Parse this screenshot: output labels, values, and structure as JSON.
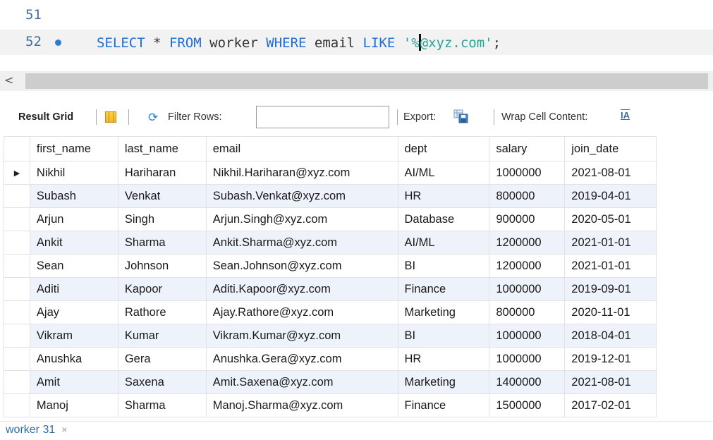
{
  "editor": {
    "lines": [
      {
        "number": "51"
      },
      {
        "number": "52"
      }
    ],
    "query": {
      "kw_select": "SELECT",
      "star": " * ",
      "kw_from": "FROM",
      "table": " worker ",
      "kw_where": "WHERE",
      "column": " email ",
      "kw_like": "LIKE",
      "space": " ",
      "str_open": "'%",
      "str_rest": "@xyz.com'",
      "semicolon": ";"
    }
  },
  "scrollbar": {
    "left_arrow": "<"
  },
  "toolbar": {
    "result_grid_label": "Result Grid",
    "filter_label": "Filter Rows:",
    "filter_value": "",
    "export_label": "Export:",
    "wrap_label": "Wrap Cell Content:",
    "wrap_icon_glyph": "IA"
  },
  "table": {
    "columns": [
      "first_name",
      "last_name",
      "email",
      "dept",
      "salary",
      "join_date"
    ],
    "rows": [
      [
        "Nikhil",
        "Hariharan",
        "Nikhil.Hariharan@xyz.com",
        "AI/ML",
        "1000000",
        "2021-08-01"
      ],
      [
        "Subash",
        "Venkat",
        "Subash.Venkat@xyz.com",
        "HR",
        "800000",
        "2019-04-01"
      ],
      [
        "Arjun",
        "Singh",
        "Arjun.Singh@xyz.com",
        "Database",
        "900000",
        "2020-05-01"
      ],
      [
        "Ankit",
        "Sharma",
        "Ankit.Sharma@xyz.com",
        "AI/ML",
        "1200000",
        "2021-01-01"
      ],
      [
        "Sean",
        "Johnson",
        "Sean.Johnson@xyz.com",
        "BI",
        "1200000",
        "2021-01-01"
      ],
      [
        "Aditi",
        "Kapoor",
        "Aditi.Kapoor@xyz.com",
        "Finance",
        "1000000",
        "2019-09-01"
      ],
      [
        "Ajay",
        "Rathore",
        "Ajay.Rathore@xyz.com",
        "Marketing",
        "800000",
        "2020-11-01"
      ],
      [
        "Vikram",
        "Kumar",
        "Vikram.Kumar@xyz.com",
        "BI",
        "1000000",
        "2018-04-01"
      ],
      [
        "Anushka",
        "Gera",
        "Anushka.Gera@xyz.com",
        "HR",
        "1000000",
        "2019-12-01"
      ],
      [
        "Amit",
        "Saxena",
        "Amit.Saxena@xyz.com",
        "Marketing",
        "1400000",
        "2021-08-01"
      ],
      [
        "Manoj",
        "Sharma",
        "Manoj.Sharma@xyz.com",
        "Finance",
        "1500000",
        "2017-02-01"
      ]
    ],
    "selected_row_marker": "▶"
  },
  "bottom_tab": {
    "label": "worker 31",
    "close": "×"
  },
  "colors": {
    "keyword": "#1f6fd1",
    "string": "#2aa198",
    "line_number": "#3f6f9e",
    "alt_row": "#eef3fb",
    "tab_text": "#2e6da4"
  },
  "icons": [
    "breakpoint-dot-icon",
    "grid-view-icon",
    "filter-refresh-icon",
    "export-save-icon",
    "wrap-text-icon",
    "close-icon"
  ]
}
